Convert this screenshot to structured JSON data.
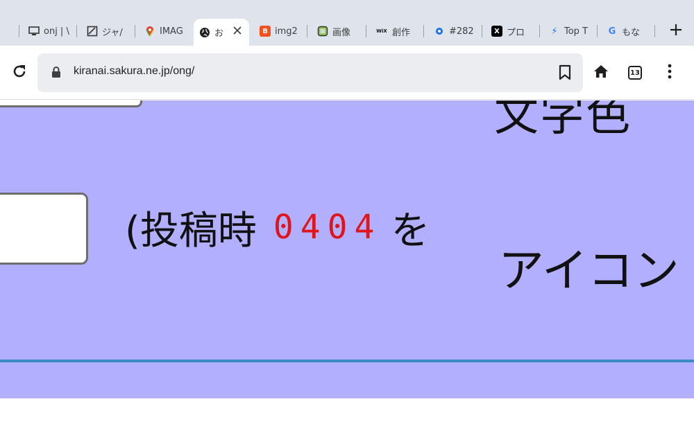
{
  "browser": {
    "tabs": [
      {
        "label": "onj | \\",
        "favicon": "monitor-icon"
      },
      {
        "label": "ジャ/",
        "favicon": "image-icon"
      },
      {
        "label": "IMAG",
        "favicon": "maps-pin-icon"
      },
      {
        "label": "お",
        "favicon": "globe-icon",
        "active": true
      },
      {
        "label": "img2",
        "favicon": "blogger-b-icon",
        "favicon_text": "B"
      },
      {
        "label": "画像",
        "favicon": "image-green-icon"
      },
      {
        "label": "創作",
        "favicon": "wix-icon",
        "favicon_text": "WiX"
      },
      {
        "label": "#282",
        "favicon": "gear-blue-icon"
      },
      {
        "label": "プロ",
        "favicon": "x-logo-icon",
        "favicon_text": "X"
      },
      {
        "label": "Top T",
        "favicon": "lightning-icon",
        "favicon_text": "⚡"
      },
      {
        "label": "もな",
        "favicon": "google-g-icon",
        "favicon_text": "G"
      }
    ],
    "url": "kiranai.sakura.ne.jp/ong/",
    "tab_count": "13",
    "colors": {
      "page_bg": "#b3afff",
      "code_red": "#e0151b",
      "divider": "#3b8cc4"
    }
  },
  "page": {
    "top_right_text": "文字色",
    "text_prefix": "(投稿時",
    "code": "0404",
    "text_suffix": "を",
    "icon_text": "アイコン"
  }
}
